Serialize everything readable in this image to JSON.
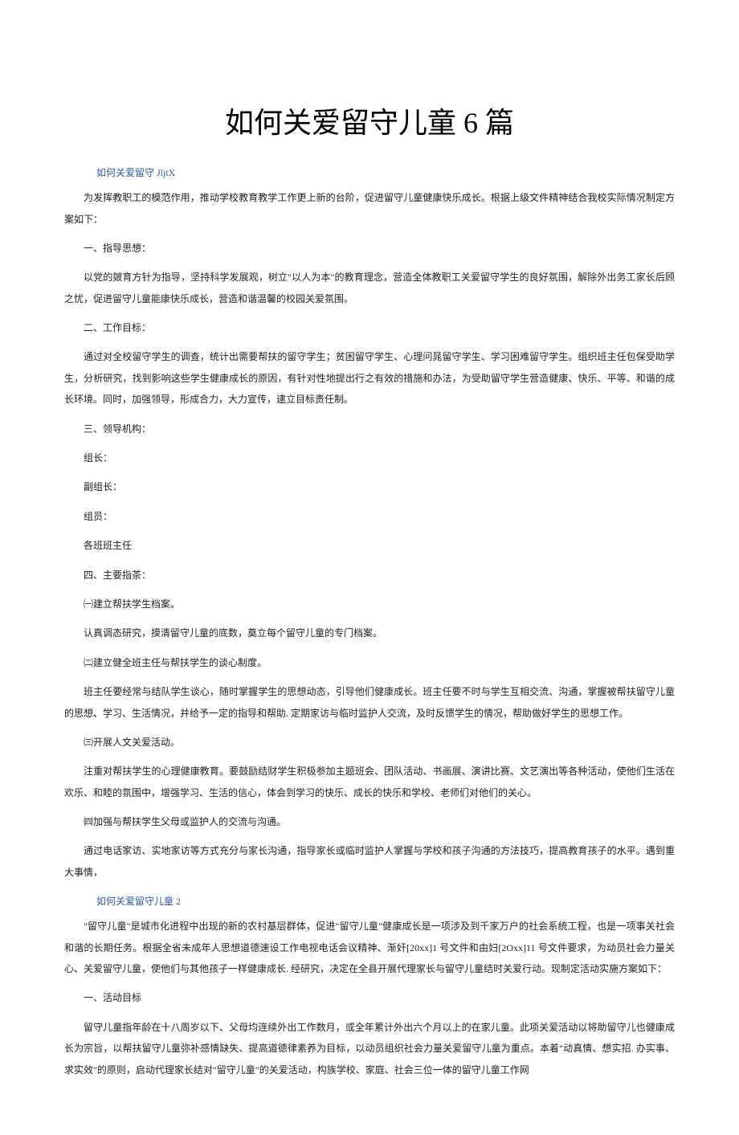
{
  "title": "如何关爱留守儿童 6 篇",
  "sec1": {
    "heading": "如何关爱留守 JljtX",
    "p1": "为发挥教职工的模范作用，推动学校教育教学工作更上新的台阶，促进留守儿童健康快乐成长。根据上级文件精神结合我校实际情况制定方案如下：",
    "p2": "一、指导思想：",
    "p3": "以党的皴育方针为指导，坚持科学发展观，树立\"以人为本\"的教育理念，营造全体教职工关爱留守学生的良好氛围，解除外出务工家长后顾之忧，促进留守儿童能康快乐成长，营造和谐温馨的校园关爱氛围。",
    "p4": "二、工作目标：",
    "p5": "通过对全校留守学生的调查，统计出需要帮扶的留守学生；贫困留守学生、心理问晁留守学生、学习困难留守学生。组织班主任包保受助学生，分析研究，找到影响这些学生健康成长的原因，有针对性地提出行之有效的措施和办法，为受助留守学生营造健康、快乐、平等、和谐的成长环境。同时，加强领导，形成合力，大力宣传，逮立目标责任制。",
    "p6": "三、领导机构：",
    "p7": "组长：",
    "p8": "副组长：",
    "p9": "组员：",
    "p10": "各班班主任",
    "p11": "四、主要指茶：",
    "p12": "㈠建立帮扶学生档案。",
    "p13": "认真调态研究，摸清留守儿童的底数，奠立每个留守儿童的专门档案。",
    "p14": "㈡建立健全班主任与帮扶学生的谈心制度。",
    "p15": "班主任要经常与结队学生谈心，随时掌握学生的思想动态，引导他们健康成长。班主任要不时与学生互相交流、沟通，掌握被帮扶留守儿童的思想、学习、生活情况，并给予一定的指导和帮助. 定期家访与临时监护人交流，及时反馈学生的情况，帮助做好学生的思想工作。",
    "p16": "㈢开展人文关爱活动。",
    "p17": "注重对帮扶学生的心理健康教育。要鼓励结财学生积极参加主题班会、团队活动、书画展、演讲比赛、文艺演出等各种活动，使他们生活在欢乐、和睦的氛围中，增强学习、生活的信心，体会到学习的快乐、成长的快乐和学校、老师们对他们的关心。",
    "p18": "㈣加强与帮扶学生父母或监护人的交流与沟通。",
    "p19": "通过电话家访、实地家访等方式充分与家长沟通，指导家长或临时监护人掌握与学校和孩子沟通的方法技巧，提高教育孩子的水平。遇到重大事情，"
  },
  "sec2": {
    "heading": "如何关爱留守儿童 2",
    "p1": "\"留守儿童\"是城市化进程中出现的新的农村基层群体，促进\"留守儿童\"健康成长是一项涉及到千家万户的社会系统工程，也是一项事关社会和谐的长期任务。根据全省未成年人思想道德速设工作电视电话会议精神、渐奸[20xx]1 号文件和由妇[2Oxx]11 号文件要求，为动员社会力量关心、关爱留守儿童，使他们与其他孩子一样健康成长. 经研究，决定在全县开展代理家长与留守儿童结时关爱行动。现制定活动实施方案如下：",
    "p2": "一、活动目标",
    "p3": "留守儿童指年龄在十八周岁以下、父母均连续外出工作数月，或全年累计外出六个月以上的在家儿童。此项关爱活动以将助留守儿也健康成长为宗旨，以帮扶留守儿童弥补感情缺失、提高道德律素养为目标，以动员组织社会力量关爱留守儿童为重点。本着\"动真情、想实招. 办实事、求实效\"的原则，启动代理家长结对\"留守儿童\"的关爱活动，构族学校、家庭、社会三位一体的留守儿童工作网"
  }
}
